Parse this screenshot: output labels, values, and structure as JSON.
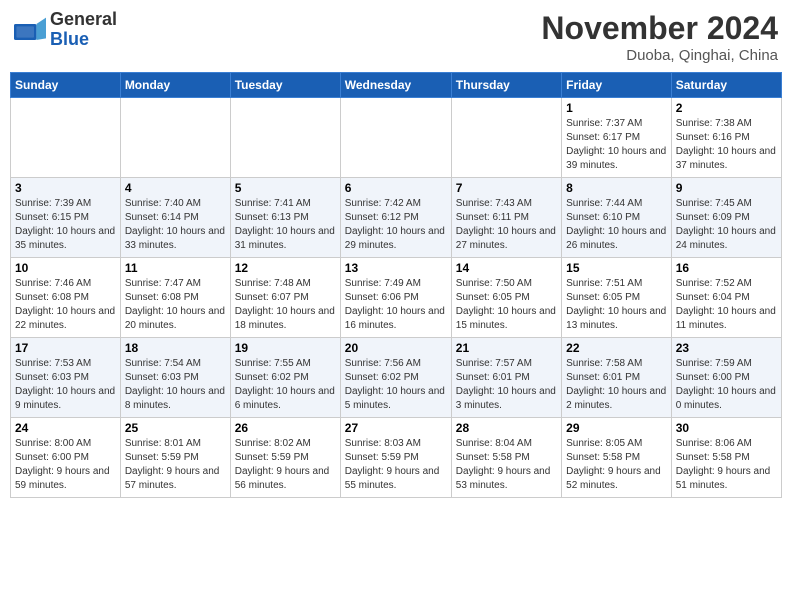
{
  "logo": {
    "general": "General",
    "blue": "Blue"
  },
  "header": {
    "month": "November 2024",
    "location": "Duoba, Qinghai, China"
  },
  "weekdays": [
    "Sunday",
    "Monday",
    "Tuesday",
    "Wednesday",
    "Thursday",
    "Friday",
    "Saturday"
  ],
  "weeks": [
    [
      {
        "day": "",
        "info": ""
      },
      {
        "day": "",
        "info": ""
      },
      {
        "day": "",
        "info": ""
      },
      {
        "day": "",
        "info": ""
      },
      {
        "day": "",
        "info": ""
      },
      {
        "day": "1",
        "info": "Sunrise: 7:37 AM\nSunset: 6:17 PM\nDaylight: 10 hours and 39 minutes."
      },
      {
        "day": "2",
        "info": "Sunrise: 7:38 AM\nSunset: 6:16 PM\nDaylight: 10 hours and 37 minutes."
      }
    ],
    [
      {
        "day": "3",
        "info": "Sunrise: 7:39 AM\nSunset: 6:15 PM\nDaylight: 10 hours and 35 minutes."
      },
      {
        "day": "4",
        "info": "Sunrise: 7:40 AM\nSunset: 6:14 PM\nDaylight: 10 hours and 33 minutes."
      },
      {
        "day": "5",
        "info": "Sunrise: 7:41 AM\nSunset: 6:13 PM\nDaylight: 10 hours and 31 minutes."
      },
      {
        "day": "6",
        "info": "Sunrise: 7:42 AM\nSunset: 6:12 PM\nDaylight: 10 hours and 29 minutes."
      },
      {
        "day": "7",
        "info": "Sunrise: 7:43 AM\nSunset: 6:11 PM\nDaylight: 10 hours and 27 minutes."
      },
      {
        "day": "8",
        "info": "Sunrise: 7:44 AM\nSunset: 6:10 PM\nDaylight: 10 hours and 26 minutes."
      },
      {
        "day": "9",
        "info": "Sunrise: 7:45 AM\nSunset: 6:09 PM\nDaylight: 10 hours and 24 minutes."
      }
    ],
    [
      {
        "day": "10",
        "info": "Sunrise: 7:46 AM\nSunset: 6:08 PM\nDaylight: 10 hours and 22 minutes."
      },
      {
        "day": "11",
        "info": "Sunrise: 7:47 AM\nSunset: 6:08 PM\nDaylight: 10 hours and 20 minutes."
      },
      {
        "day": "12",
        "info": "Sunrise: 7:48 AM\nSunset: 6:07 PM\nDaylight: 10 hours and 18 minutes."
      },
      {
        "day": "13",
        "info": "Sunrise: 7:49 AM\nSunset: 6:06 PM\nDaylight: 10 hours and 16 minutes."
      },
      {
        "day": "14",
        "info": "Sunrise: 7:50 AM\nSunset: 6:05 PM\nDaylight: 10 hours and 15 minutes."
      },
      {
        "day": "15",
        "info": "Sunrise: 7:51 AM\nSunset: 6:05 PM\nDaylight: 10 hours and 13 minutes."
      },
      {
        "day": "16",
        "info": "Sunrise: 7:52 AM\nSunset: 6:04 PM\nDaylight: 10 hours and 11 minutes."
      }
    ],
    [
      {
        "day": "17",
        "info": "Sunrise: 7:53 AM\nSunset: 6:03 PM\nDaylight: 10 hours and 9 minutes."
      },
      {
        "day": "18",
        "info": "Sunrise: 7:54 AM\nSunset: 6:03 PM\nDaylight: 10 hours and 8 minutes."
      },
      {
        "day": "19",
        "info": "Sunrise: 7:55 AM\nSunset: 6:02 PM\nDaylight: 10 hours and 6 minutes."
      },
      {
        "day": "20",
        "info": "Sunrise: 7:56 AM\nSunset: 6:02 PM\nDaylight: 10 hours and 5 minutes."
      },
      {
        "day": "21",
        "info": "Sunrise: 7:57 AM\nSunset: 6:01 PM\nDaylight: 10 hours and 3 minutes."
      },
      {
        "day": "22",
        "info": "Sunrise: 7:58 AM\nSunset: 6:01 PM\nDaylight: 10 hours and 2 minutes."
      },
      {
        "day": "23",
        "info": "Sunrise: 7:59 AM\nSunset: 6:00 PM\nDaylight: 10 hours and 0 minutes."
      }
    ],
    [
      {
        "day": "24",
        "info": "Sunrise: 8:00 AM\nSunset: 6:00 PM\nDaylight: 9 hours and 59 minutes."
      },
      {
        "day": "25",
        "info": "Sunrise: 8:01 AM\nSunset: 5:59 PM\nDaylight: 9 hours and 57 minutes."
      },
      {
        "day": "26",
        "info": "Sunrise: 8:02 AM\nSunset: 5:59 PM\nDaylight: 9 hours and 56 minutes."
      },
      {
        "day": "27",
        "info": "Sunrise: 8:03 AM\nSunset: 5:59 PM\nDaylight: 9 hours and 55 minutes."
      },
      {
        "day": "28",
        "info": "Sunrise: 8:04 AM\nSunset: 5:58 PM\nDaylight: 9 hours and 53 minutes."
      },
      {
        "day": "29",
        "info": "Sunrise: 8:05 AM\nSunset: 5:58 PM\nDaylight: 9 hours and 52 minutes."
      },
      {
        "day": "30",
        "info": "Sunrise: 8:06 AM\nSunset: 5:58 PM\nDaylight: 9 hours and 51 minutes."
      }
    ]
  ]
}
